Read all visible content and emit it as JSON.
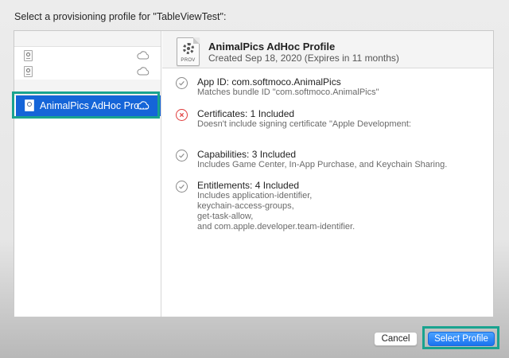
{
  "dialog": {
    "title": "Select a provisioning profile for \"TableViewTest\":"
  },
  "sidebar": {
    "groups": [
      {
        "items": [
          {
            "label": "",
            "icon": "provisioning-profile-icon",
            "status_icon": "cloud-icon"
          },
          {
            "label": "",
            "icon": "provisioning-profile-icon",
            "status_icon": "cloud-icon"
          }
        ]
      }
    ],
    "selected": {
      "label": "AnimalPics AdHoc Pro...",
      "icon": "provisioning-profile-icon",
      "status_icon": "cloud-icon"
    }
  },
  "detail": {
    "icon_label": "PROV",
    "title": "AnimalPics AdHoc Profile",
    "subtitle": "Created Sep 18, 2020 (Expires in 11 months)",
    "sections": [
      {
        "status": "ok",
        "title": "App ID: com.softmoco.AnimalPics",
        "desc": [
          "Matches bundle ID \"com.softmoco.AnimalPics\""
        ]
      },
      {
        "status": "error",
        "title": "Certificates: 1 Included",
        "desc": [
          "Doesn't include signing certificate \"Apple Development:"
        ]
      },
      {
        "status": "ok",
        "title": "Capabilities: 3 Included",
        "desc": [
          "Includes Game Center, In-App Purchase, and Keychain Sharing."
        ]
      },
      {
        "status": "ok",
        "title": "Entitlements: 4 Included",
        "desc": [
          "Includes application-identifier,",
          "keychain-access-groups,",
          "get-task-allow,",
          "and com.apple.developer.team-identifier."
        ]
      }
    ]
  },
  "buttons": {
    "cancel": "Cancel",
    "select": "Select Profile"
  },
  "colors": {
    "selection": "#1565d8",
    "highlight": "#19a38f",
    "error": "#e03c3c",
    "primary_button": "#1a74f0"
  }
}
